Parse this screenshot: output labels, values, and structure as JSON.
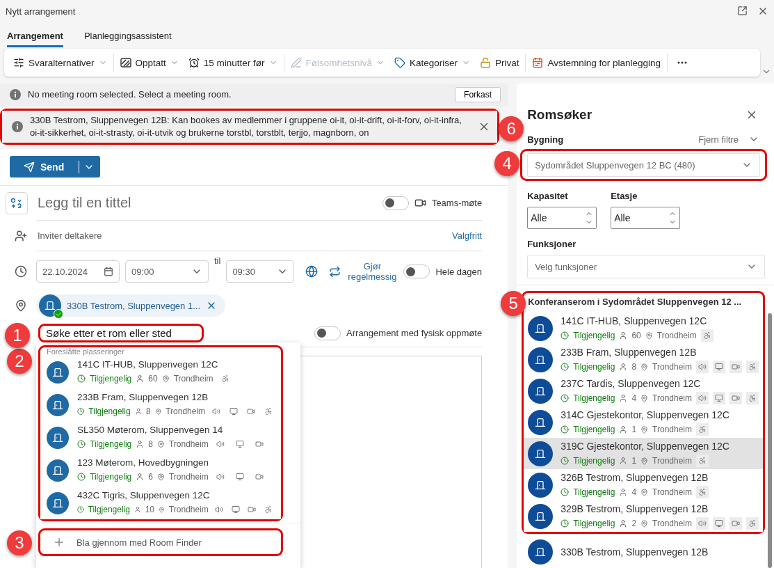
{
  "window": {
    "title": "Nytt arrangement"
  },
  "tabs": [
    {
      "label": "Arrangement",
      "selected": true
    },
    {
      "label": "Planleggingsassistent",
      "selected": false
    }
  ],
  "toolbar": [
    [
      {
        "kind": "options",
        "label": "Svaralternativer",
        "dropdown": true,
        "disabled": false
      }
    ],
    [
      {
        "kind": "availability",
        "label": "Opptatt",
        "dropdown": true,
        "disabled": false
      },
      {
        "kind": "reminder",
        "label": "15 minutter før",
        "dropdown": true,
        "disabled": false
      }
    ],
    [
      {
        "kind": "sensitivity",
        "label": "Følsomhetsnivå",
        "dropdown": true,
        "disabled": true
      },
      {
        "kind": "categorize",
        "label": "Kategoriser",
        "dropdown": true,
        "disabled": false
      },
      {
        "kind": "private",
        "label": "Privat",
        "dropdown": false,
        "disabled": false
      }
    ],
    [
      {
        "kind": "poll",
        "label": "Avstemning for planlegging",
        "dropdown": false,
        "disabled": false
      }
    ]
  ],
  "notices": [
    {
      "text": "No meeting room selected. Select a meeting room.",
      "action": "Forkast",
      "dismissible": false
    },
    {
      "text": "330B Testrom, Sluppenvegen 12B: Kan bookes av medlemmer i gruppene oi-it, oi-it-drift, oi-it-forv, oi-it-infra, oi-it-sikkerhet, oi-it-strasty, oi-it-utvik og brukerne torstbl, torstblt, terjjo, magnborn, on",
      "dismissible": true,
      "callout": "6"
    }
  ],
  "send": {
    "label": "Send"
  },
  "form": {
    "title_placeholder": "Legg til en tittel",
    "teams": {
      "label": "Teams-møte",
      "on": false
    },
    "attendees_placeholder": "Inviter deltakere",
    "optional_link": "Valgfritt",
    "date": "22.10.2024",
    "start": "09:00",
    "to_label": "til",
    "end": "09:30",
    "recurring": "Gjør regelmessig",
    "all_day": {
      "label": "Hele dagen",
      "on": false
    },
    "location_chip": "330B Testrom, Sluppenvegen 1...",
    "location_search": {
      "value": "Søke etter et rom eller sted",
      "callout": "1"
    },
    "in_person": {
      "label": "Arrangement med fysisk oppmøte",
      "on": false
    }
  },
  "suggestions": {
    "header": "Foreslåtte plasseringer",
    "callout": "2",
    "rooms": [
      {
        "name": "141C IT-HUB, Sluppenvegen 12C",
        "status": "Tilgjengelig",
        "capacity": "60",
        "city": "Trondheim",
        "features": [
          {
            "kind": "accessible"
          }
        ]
      },
      {
        "name": "233B Fram, Sluppenvegen 12B",
        "status": "Tilgjengelig",
        "capacity": "8",
        "city": "Trondheim",
        "features": [
          {
            "kind": "audio"
          },
          {
            "kind": "display"
          },
          {
            "kind": "video"
          },
          {
            "kind": "accessible"
          }
        ]
      },
      {
        "name": "SL350 Møterom, Sluppenvegen 14",
        "status": "Tilgjengelig",
        "capacity": "8",
        "city": "Trondheim",
        "features": [
          {
            "kind": "audio"
          },
          {
            "kind": "display"
          },
          {
            "kind": "video"
          }
        ]
      },
      {
        "name": "123 Møterom, Hovedbygningen",
        "status": "Tilgjengelig",
        "capacity": "6",
        "city": "Trondheim",
        "features": [
          {
            "kind": "audio"
          },
          {
            "kind": "display"
          },
          {
            "kind": "video"
          }
        ]
      },
      {
        "name": "432C Tigris, Sluppenvegen 12C",
        "status": "Tilgjengelig",
        "capacity": "10",
        "city": "Trondheim",
        "features": [
          {
            "kind": "audio"
          },
          {
            "kind": "display"
          },
          {
            "kind": "video"
          },
          {
            "kind": "accessible"
          }
        ]
      }
    ],
    "browse": {
      "label": "Bla gjennom med Room Finder",
      "callout": "3"
    }
  },
  "room_finder": {
    "title": "Romsøker",
    "building_label": "Bygning",
    "clear_filters": "Fjern filtre",
    "building": {
      "value": "Sydområdet Sluppenvegen 12 BC (480)",
      "callout": "4"
    },
    "capacity": {
      "label": "Kapasitet",
      "value": "Alle"
    },
    "floor": {
      "label": "Etasje",
      "value": "Alle"
    },
    "functions": {
      "label": "Funksjoner",
      "placeholder": "Velg funksjoner"
    },
    "list": {
      "header": "Konferanserom i Sydområdet Sluppenvegen 12 ...",
      "callout": "5",
      "rooms": [
        {
          "name": "141C IT-HUB, Sluppenvegen 12C",
          "status": "Tilgjengelig",
          "capacity": "60",
          "city": "Trondheim",
          "hovered": false,
          "features": [
            {
              "kind": "accessible"
            }
          ]
        },
        {
          "name": "233B Fram, Sluppenvegen 12B",
          "status": "Tilgjengelig",
          "capacity": "8",
          "city": "Trondheim",
          "hovered": false,
          "features": [
            {
              "kind": "audio"
            },
            {
              "kind": "display"
            },
            {
              "kind": "video"
            },
            {
              "kind": "accessible"
            }
          ]
        },
        {
          "name": "237C Tardis, Sluppenvegen 12C",
          "status": "Tilgjengelig",
          "capacity": "4",
          "city": "Trondheim",
          "hovered": false,
          "features": [
            {
              "kind": "audio"
            },
            {
              "kind": "display"
            },
            {
              "kind": "video"
            },
            {
              "kind": "accessible"
            }
          ]
        },
        {
          "name": "314C Gjestekontor, Sluppenvegen 12C",
          "status": "Tilgjengelig",
          "capacity": "1",
          "city": "Trondheim",
          "hovered": false,
          "features": [
            {
              "kind": "accessible"
            }
          ]
        },
        {
          "name": "319C Gjestekontor, Sluppenvegen 12C",
          "status": "Tilgjengelig",
          "capacity": "1",
          "city": "Trondheim",
          "hovered": true,
          "features": [
            {
              "kind": "accessible"
            }
          ]
        },
        {
          "name": "326B Testrom, Sluppenvegen 12B",
          "status": "Tilgjengelig",
          "capacity": "4",
          "city": "Trondheim",
          "hovered": false,
          "features": [
            {
              "kind": "accessible"
            }
          ]
        },
        {
          "name": "329B Testrom, Sluppenvegen 12B",
          "status": "Tilgjengelig",
          "capacity": "2",
          "city": "Trondheim",
          "hovered": false,
          "features": [
            {
              "kind": "audio"
            },
            {
              "kind": "display"
            },
            {
              "kind": "video"
            },
            {
              "kind": "accessible"
            }
          ]
        }
      ]
    },
    "more_rooms": [
      {
        "name": "330B Testrom, Sluppenvegen 12B",
        "hovered": false
      }
    ]
  }
}
